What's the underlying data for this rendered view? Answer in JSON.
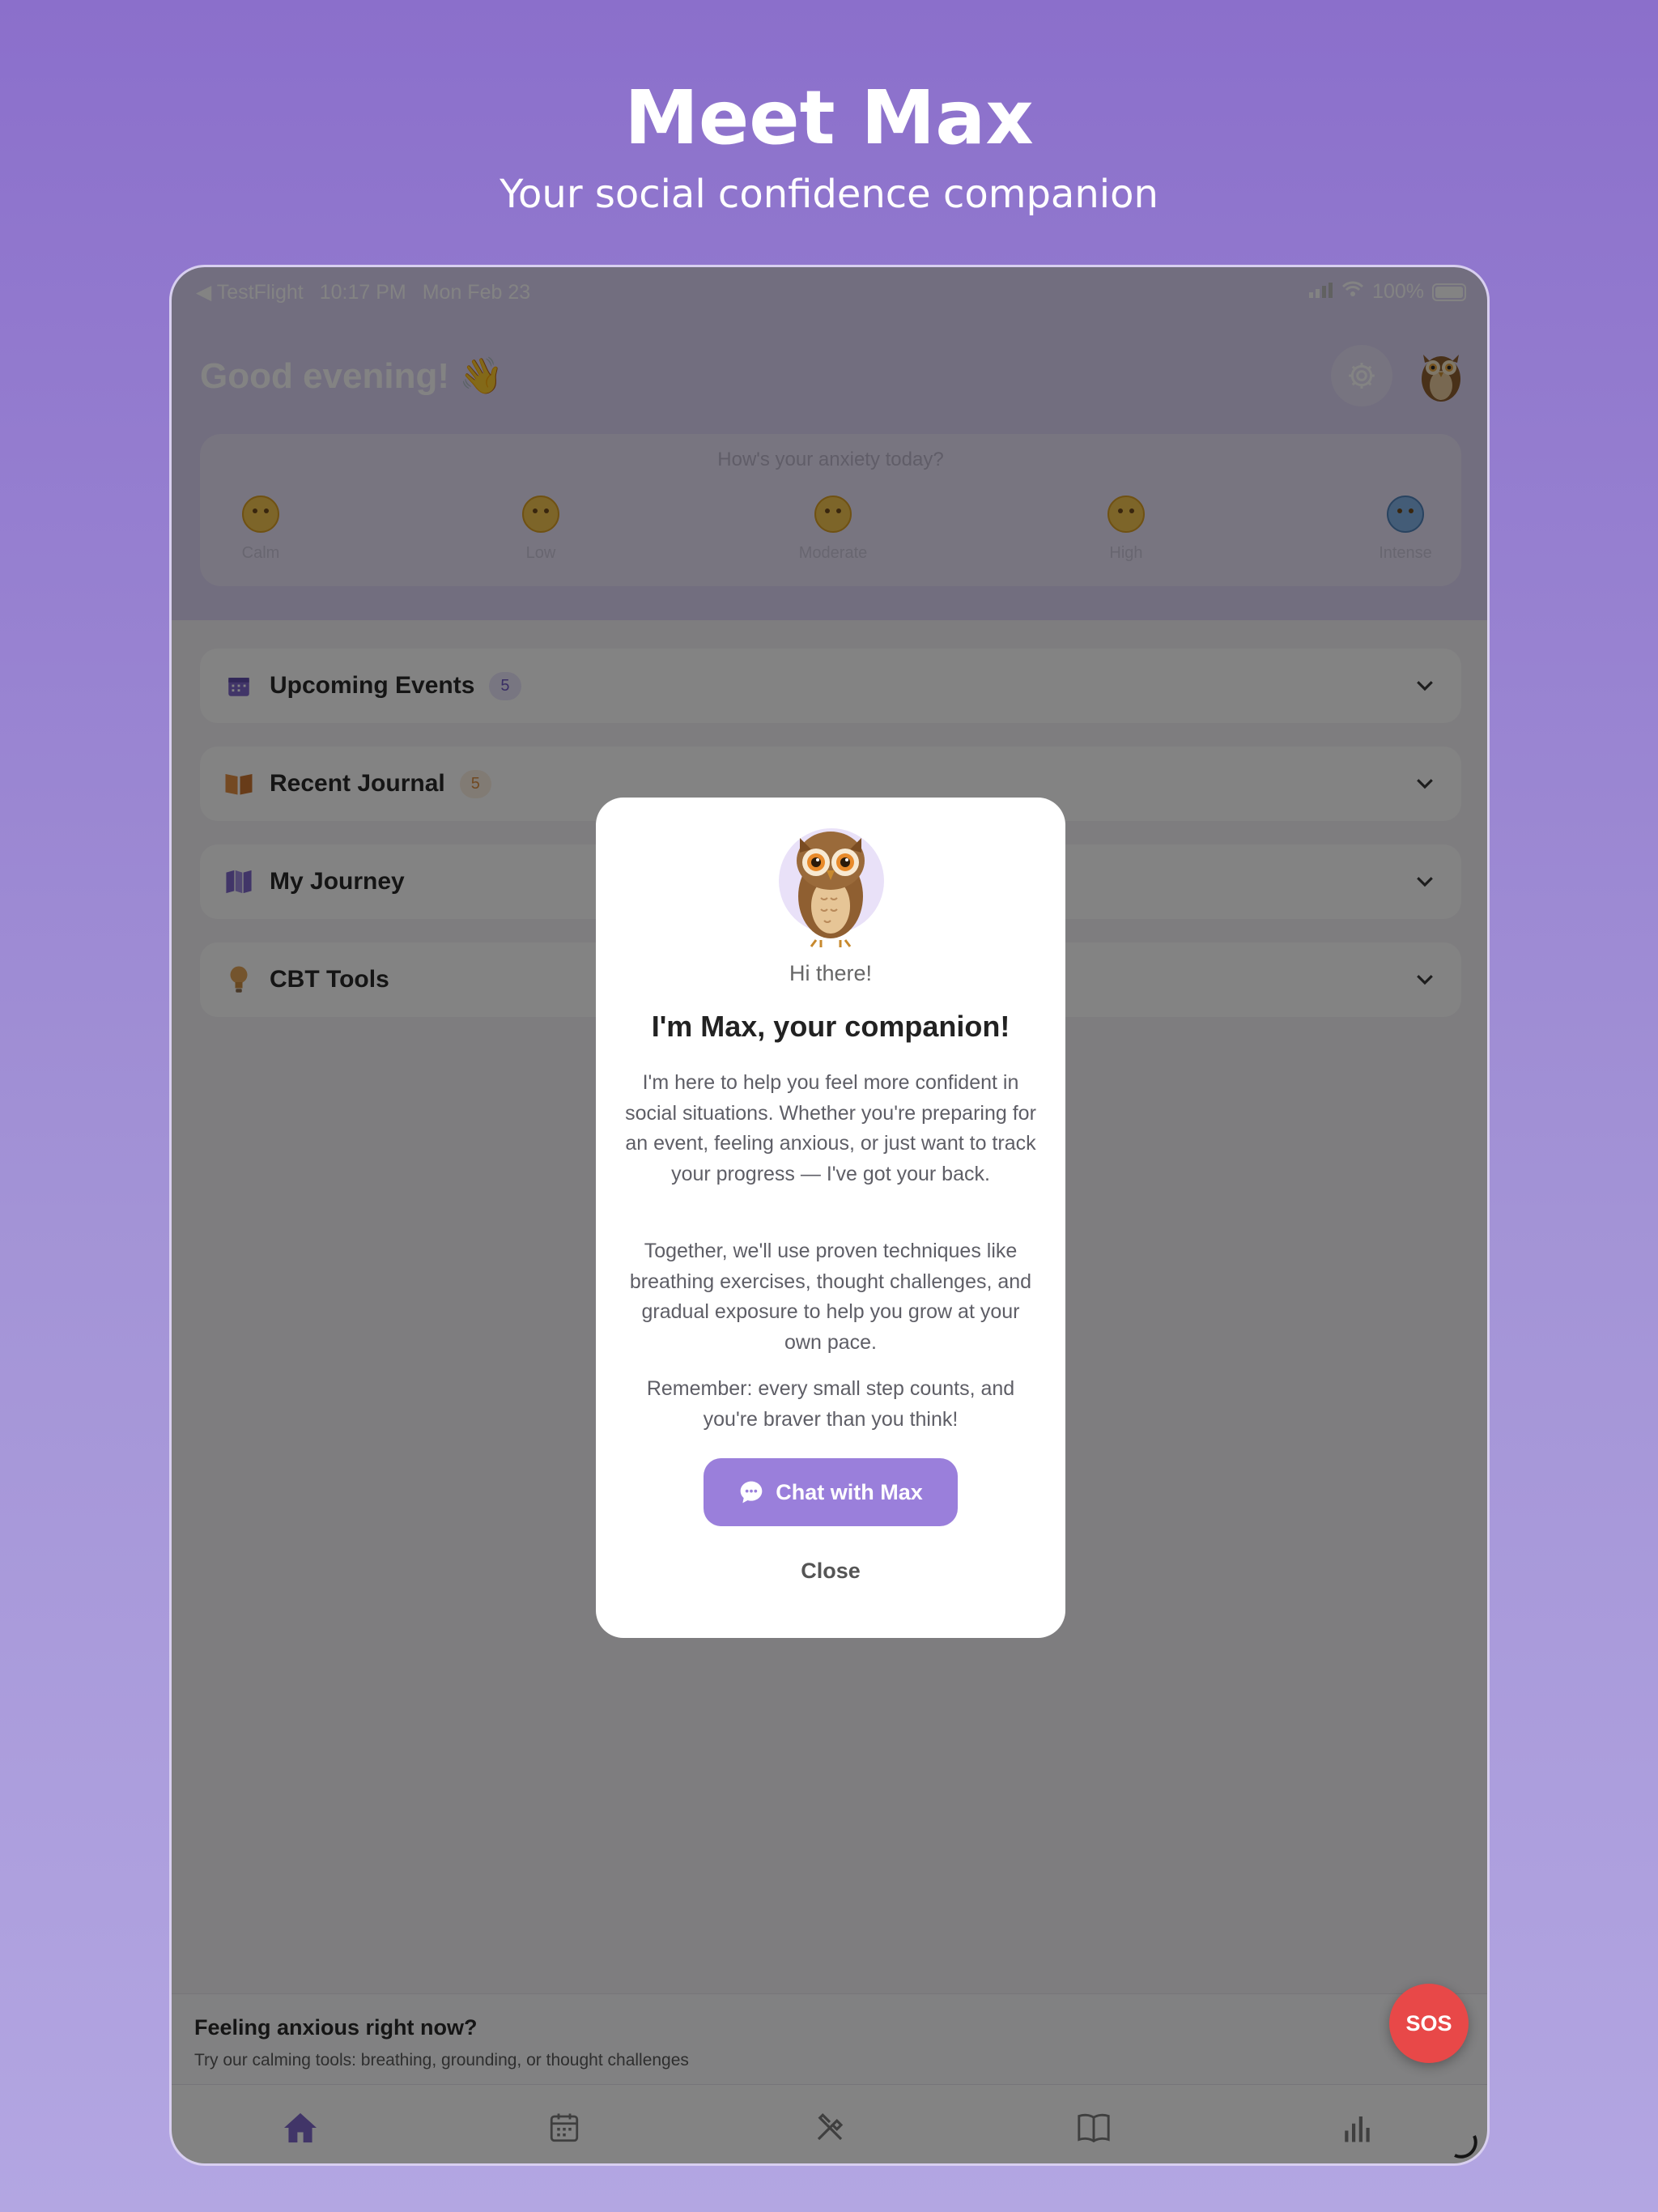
{
  "hero": {
    "title": "Meet Max",
    "subtitle": "Your social confidence companion"
  },
  "status_bar": {
    "back_app": "◀ TestFlight",
    "time": "10:17 PM",
    "date": "Mon Feb 23",
    "battery": "100%"
  },
  "header": {
    "greeting": "Good evening! 👋",
    "settings_icon": "gear-icon",
    "avatar_icon": "owl-icon"
  },
  "mood": {
    "question": "How's your anxiety today?",
    "options": [
      {
        "label": "Calm"
      },
      {
        "label": "Low"
      },
      {
        "label": "Moderate"
      },
      {
        "label": "High"
      },
      {
        "label": "Intense"
      }
    ]
  },
  "sections": [
    {
      "title": "Upcoming Events",
      "badge": "5",
      "icon": "calendar-icon"
    },
    {
      "title": "Recent Journal",
      "badge": "5",
      "icon": "book-icon"
    },
    {
      "title": "My Journey",
      "icon": "map-icon"
    },
    {
      "title": "CBT Tools",
      "icon": "lightbulb-icon"
    }
  ],
  "anxious_banner": {
    "title": "Feeling anxious right now?",
    "subtitle": "Try our calming tools: breathing, grounding, or thought challenges",
    "sos_label": "SOS"
  },
  "tabs": [
    "home-icon",
    "calendar-icon",
    "tools-icon",
    "book-icon",
    "chart-icon"
  ],
  "modal": {
    "greeting": "Hi there!",
    "title": "I'm Max, your companion!",
    "paragraph1": "I'm here to help you feel more confident in social situations. Whether you're preparing for an event, feeling anxious, or just want to track your progress — I've got your back.",
    "paragraph2": "Together, we'll use proven techniques like breathing exercises, thought challenges, and gradual exposure to help you grow at your own pace.",
    "paragraph3": "Remember: every small step counts, and you're braver than you think!",
    "chat_button": "Chat with Max",
    "close_button": "Close"
  },
  "colors": {
    "accent": "#9a7fdb",
    "sos": "#e84848",
    "background_top": "#8b6fcb"
  }
}
